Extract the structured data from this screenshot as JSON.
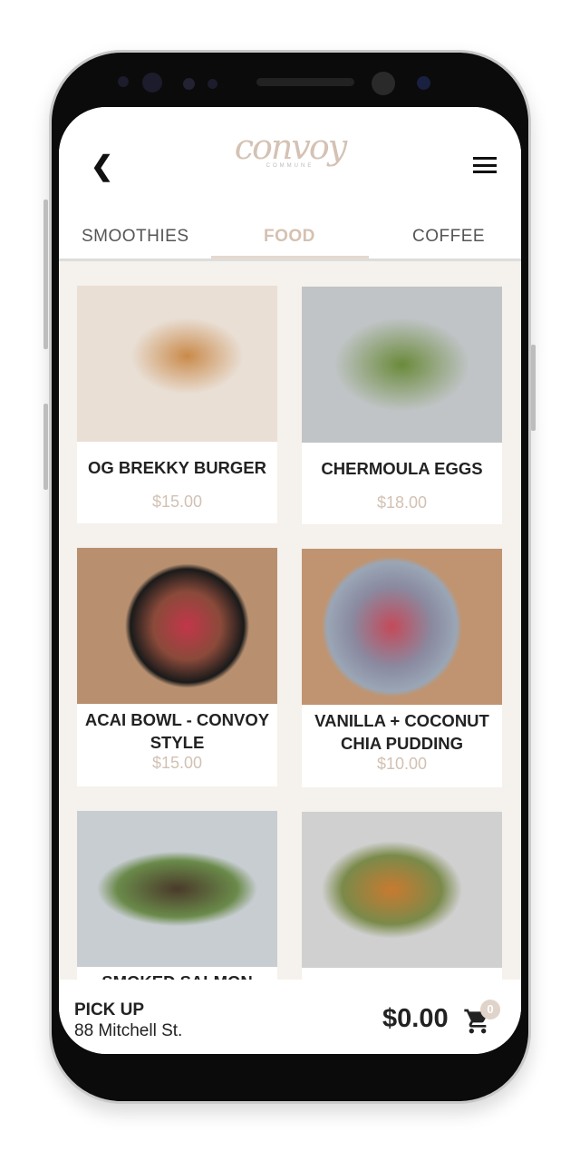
{
  "header": {
    "back_icon": "chevron-left-icon",
    "logo_text": "convoy",
    "logo_subtext": "COMMUNE",
    "menu_icon": "hamburger-icon"
  },
  "tabs": [
    {
      "label": "SMOOTHIES"
    },
    {
      "label": "FOOD",
      "active": true
    },
    {
      "label": "COFFEE"
    }
  ],
  "accent_color": "#d5c1b1",
  "items": [
    {
      "name": "OG BREKKY BURGER",
      "price": "$15.00"
    },
    {
      "name": "CHERMOULA EGGS",
      "price": "$18.00"
    },
    {
      "name": "ACAI BOWL - CONVOY STYLE",
      "price": "$15.00"
    },
    {
      "name": "VANILLA + COCONUT CHIA PUDDING",
      "price": "$10.00"
    },
    {
      "name": "SMOKED SALMON",
      "price": ""
    },
    {
      "name": "",
      "price": ""
    }
  ],
  "footer": {
    "mode": "PICK UP",
    "address": "88 Mitchell St.",
    "total": "$0.00",
    "cart_count": "0",
    "cart_icon": "shopping-cart-icon"
  }
}
